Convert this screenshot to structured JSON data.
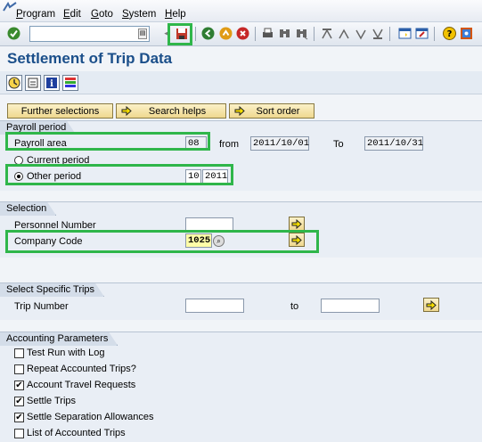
{
  "menu": [
    "Program",
    "Edit",
    "Goto",
    "System",
    "Help"
  ],
  "title": "Settlement of Trip Data",
  "buttons": {
    "further_selections": "Further selections",
    "search_helps": "Search helps",
    "sort_order": "Sort order"
  },
  "payroll": {
    "title": "Payroll period",
    "area_label": "Payroll area",
    "area_value": "08",
    "from_label": "from",
    "from_value": "2011/10/01",
    "to_label": "To",
    "to_value": "2011/10/31",
    "current_label": "Current period",
    "other_label": "Other period",
    "other_period": "10",
    "other_year": "2011",
    "selected": "other"
  },
  "selection": {
    "title": "Selection",
    "personnel_label": "Personnel Number",
    "personnel_value": "",
    "company_label": "Company Code",
    "company_value": "1025"
  },
  "trips": {
    "title": "Select Specific Trips",
    "number_label": "Trip Number",
    "to_label": "to",
    "from_value": "",
    "to_value": ""
  },
  "accounting": {
    "title": "Accounting Parameters",
    "options": [
      {
        "label": "Test Run with Log",
        "checked": false
      },
      {
        "label": "Repeat Accounted Trips?",
        "checked": false
      },
      {
        "label": "Account Travel Requests",
        "checked": true
      },
      {
        "label": "Settle Trips",
        "checked": true
      },
      {
        "label": "Settle Separation Allowances",
        "checked": true
      },
      {
        "label": "List of Accounted Trips",
        "checked": false
      }
    ]
  },
  "colors": {
    "title": "#1b4f8a",
    "highlight": "#2fb64a",
    "button": "#efd88f"
  }
}
